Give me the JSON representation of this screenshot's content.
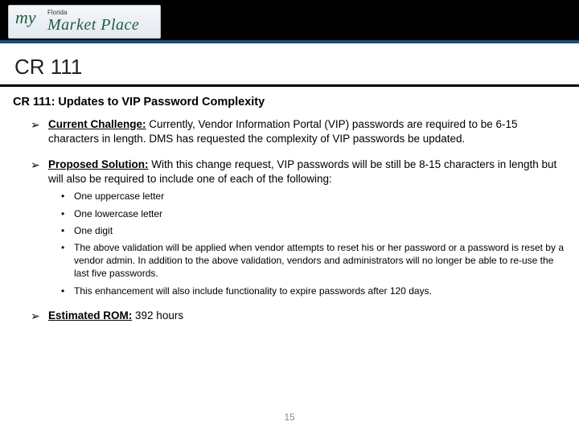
{
  "logo": {
    "my": "my",
    "florida": "Florida",
    "marketplace": "Market Place"
  },
  "title": "CR 111",
  "section_title": "CR 111: Updates to VIP Password Complexity",
  "bullets": [
    {
      "label": "Current Challenge:",
      "text": "  Currently, Vendor Information Portal (VIP) passwords are required to be 6-15 characters in length.  DMS has requested the complexity of VIP passwords be updated."
    },
    {
      "label": "Proposed Solution:",
      "text": " With this change request, VIP passwords will be still be 8-15 characters in length but will also be required to include one of each of the following:",
      "sub": [
        "One uppercase letter",
        "One lowercase letter",
        "One digit",
        " The above validation will be applied when vendor attempts to reset his or her password or a password is reset by a vendor admin.  In addition to the above validation, vendors and administrators will no longer be able to re-use the last five passwords.",
        " This enhancement will also include functionality to expire passwords after 120 days."
      ]
    },
    {
      "label": "Estimated ROM:",
      "text": " 392 hours"
    }
  ],
  "page_number": "15"
}
